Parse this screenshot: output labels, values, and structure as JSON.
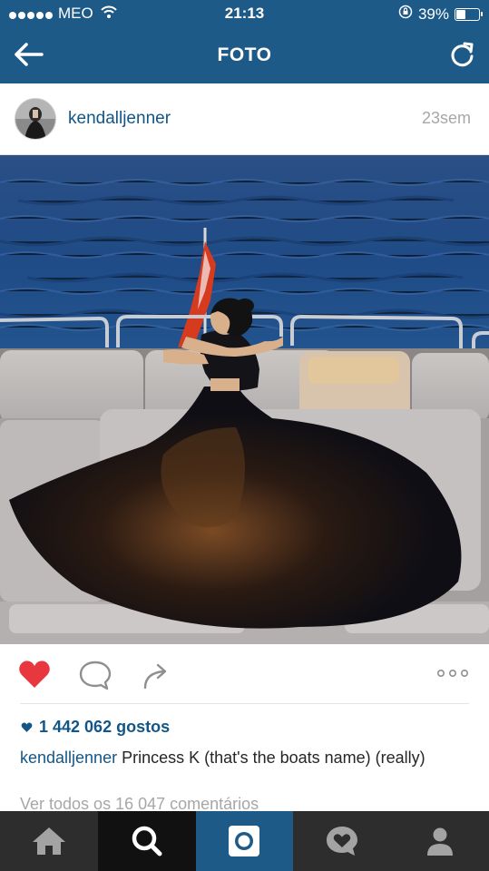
{
  "status_bar": {
    "carrier": "MEO",
    "time": "21:13",
    "battery": "39%",
    "battery_level": 0.39
  },
  "nav": {
    "title": "FOTO"
  },
  "post": {
    "username": "kendalljenner",
    "time_ago": "23sem",
    "likes": "1 442 062 gostos",
    "caption_user": "kendalljenner",
    "caption_text": "Princess K (that's the boats name) (really)",
    "comments_link": "Ver todos os 16 047 comentários",
    "liked": true
  },
  "icons": {
    "back": "arrow-left-icon",
    "refresh": "refresh-icon",
    "like": "heart-icon",
    "comment": "speech-bubble-icon",
    "share": "share-arrow-icon",
    "more": "more-dots-icon"
  },
  "tabs": [
    {
      "name": "home",
      "icon": "home-icon"
    },
    {
      "name": "search",
      "icon": "search-icon"
    },
    {
      "name": "camera",
      "icon": "camera-icon"
    },
    {
      "name": "activity",
      "icon": "activity-heart-icon"
    },
    {
      "name": "profile",
      "icon": "profile-icon"
    }
  ],
  "colors": {
    "brand_blue": "#1e5a88",
    "link_blue": "#125688",
    "like_red": "#e8373f",
    "tabbar_bg": "#2d2d2d"
  }
}
